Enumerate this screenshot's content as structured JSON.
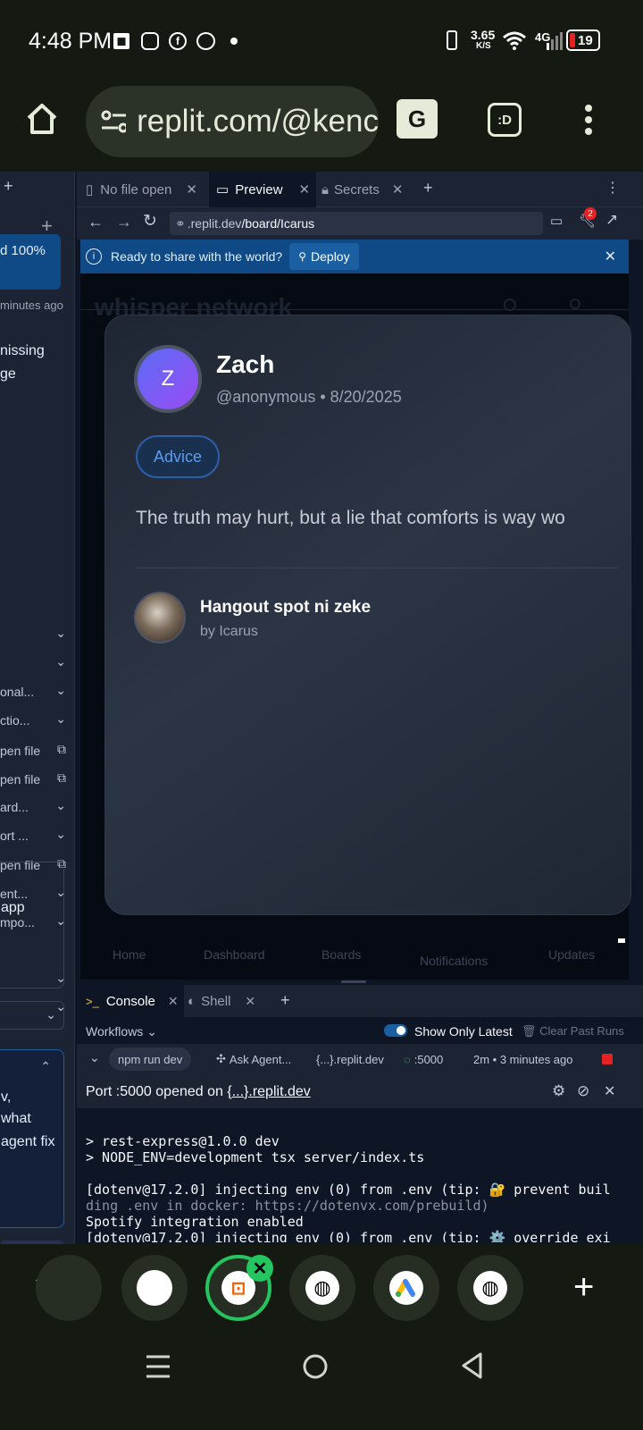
{
  "status_bar": {
    "time": "4:48 PM",
    "net_speed": "3.65",
    "net_unit": "K/S",
    "network": "4G",
    "battery": "19"
  },
  "browser": {
    "url": "replit.com/@kenc",
    "tab_count": ":D"
  },
  "sidebar": {
    "progress_text": "d 100%",
    "time_text": "minutes ago",
    "msg_line1": "nissing",
    "msg_line2": "ge",
    "items": [
      "",
      "",
      "onal...",
      "ctio...",
      "pen file",
      "pen file",
      "ard...",
      "ort ...",
      "pen file",
      "ent...",
      "mpo...",
      "",
      ""
    ],
    "app_text": "app",
    "agent_line1": "v,",
    "agent_line2": "what",
    "agent_line3": "agent fix"
  },
  "tabs": [
    {
      "label": "No file open"
    },
    {
      "label": "Preview"
    },
    {
      "label": "Secrets"
    }
  ],
  "preview_nav": {
    "address_prefix": ".replit.dev",
    "address_path": "/board/Icarus",
    "notif_count": "2"
  },
  "banner": {
    "text": "Ready to share with the world?",
    "deploy_label": "Deploy"
  },
  "site": {
    "logo_text": "whisper network",
    "post": {
      "avatar_letter": "Z",
      "name": "Zach",
      "handle_date": "@anonymous • 8/20/2025",
      "tag": "Advice",
      "body": "The truth may hurt, but a lie that comforts is way wo",
      "board_title": "Hangout spot ni zeke",
      "board_by": "by Icarus"
    },
    "nav": [
      "Home",
      "Dashboard",
      "Boards",
      "Notifications",
      "Updates"
    ]
  },
  "console": {
    "tabs": [
      {
        "label": "Console"
      },
      {
        "label": "Shell"
      }
    ],
    "workflows_label": "Workflows",
    "show_latest_label": "Show Only Latest",
    "clear_label": "Clear Past Runs",
    "run": {
      "command": "npm run dev",
      "ask_agent": "Ask Agent...",
      "domain": "{...}.replit.dev",
      "port": ":5000",
      "time": "2m • 3 minutes ago"
    },
    "port_msg_prefix": "Port :5000 opened on ",
    "port_msg_link": "{...}.replit.dev",
    "log_lines": [
      "> rest-express@1.0.0 dev",
      "> NODE_ENV=development tsx server/index.ts",
      "",
      "[dotenv@17.2.0] injecting env (0) from .env (tip: 🔐 prevent buil",
      "ding .env in docker: https://dotenvx.com/prebuild)",
      "Spotify integration enabled",
      "[dotenv@17.2.0] injecting env (0) from .env (tip: ⚙️ override exi"
    ]
  },
  "colors": {
    "accent": "#0f4a87",
    "ide_bg": "#0e1525",
    "panel_bg": "#1c2333",
    "stop": "#e52222",
    "focus_ring": "#22c55e"
  }
}
